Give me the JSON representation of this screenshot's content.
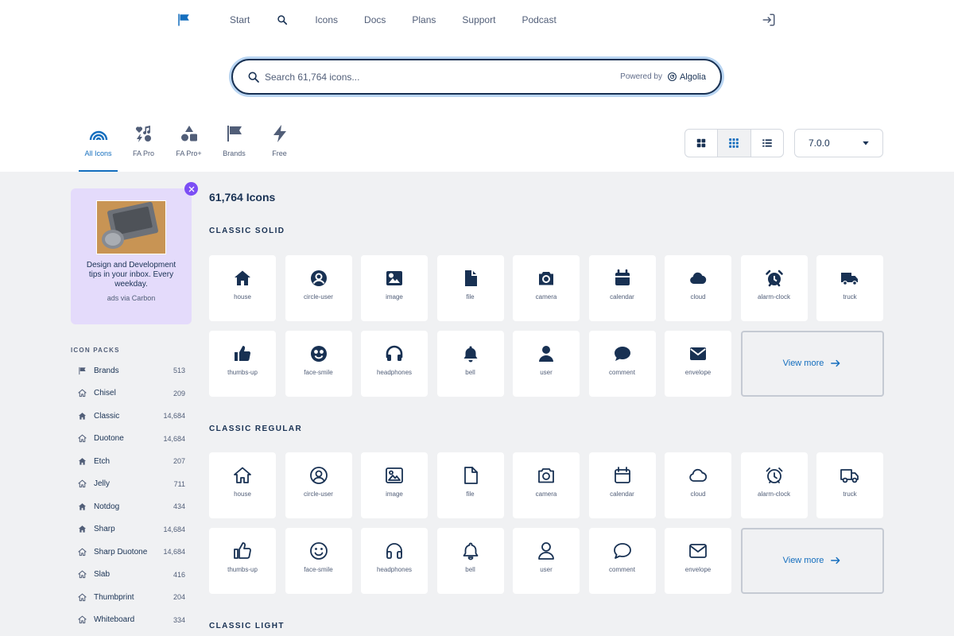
{
  "nav": {
    "items": [
      {
        "label": "Start"
      },
      {
        "label": "Icons"
      },
      {
        "label": "Docs"
      },
      {
        "label": "Plans"
      },
      {
        "label": "Support"
      },
      {
        "label": "Podcast"
      }
    ]
  },
  "search": {
    "placeholder": "Search 61,764 icons...",
    "value": "",
    "powered_by": "Powered by",
    "provider": "Algolia"
  },
  "family_tabs": [
    {
      "label": "All Icons",
      "icon": "rainbow-icon",
      "active": true
    },
    {
      "label": "FA Pro",
      "icon": "icons-icon",
      "active": false
    },
    {
      "label": "FA Pro+",
      "icon": "shapes-icon",
      "active": false
    },
    {
      "label": "Brands",
      "icon": "flag-icon",
      "active": false
    },
    {
      "label": "Free",
      "icon": "bolt-icon",
      "active": false
    }
  ],
  "view_toggle": {
    "options": [
      "large-grid",
      "small-grid",
      "list"
    ],
    "selected": "small-grid"
  },
  "version": {
    "selected": "7.0.0"
  },
  "carbon_ad": {
    "text": "Design and Development tips in your inbox. Every weekday.",
    "via": "ads via Carbon"
  },
  "packs": {
    "title": "ICON PACKS",
    "items": [
      {
        "name": "Brands",
        "count": "513",
        "icon": "flag-icon"
      },
      {
        "name": "Chisel",
        "count": "209",
        "icon": "house-icon"
      },
      {
        "name": "Classic",
        "count": "14,684",
        "icon": "house-icon"
      },
      {
        "name": "Duotone",
        "count": "14,684",
        "icon": "house-icon"
      },
      {
        "name": "Etch",
        "count": "207",
        "icon": "house-icon"
      },
      {
        "name": "Jelly",
        "count": "711",
        "icon": "house-icon"
      },
      {
        "name": "Notdog",
        "count": "434",
        "icon": "house-icon"
      },
      {
        "name": "Sharp",
        "count": "14,684",
        "icon": "house-icon"
      },
      {
        "name": "Sharp Duotone",
        "count": "14,684",
        "icon": "house-icon"
      },
      {
        "name": "Slab",
        "count": "416",
        "icon": "house-icon"
      },
      {
        "name": "Thumbprint",
        "count": "204",
        "icon": "house-icon"
      },
      {
        "name": "Whiteboard",
        "count": "334",
        "icon": "house-icon"
      }
    ]
  },
  "main": {
    "count_title": "61,764 Icons",
    "view_more": "View more",
    "sections": [
      {
        "title": "CLASSIC SOLID",
        "style": "solid",
        "icons": [
          "house",
          "circle-user",
          "image",
          "file",
          "camera",
          "calendar",
          "cloud",
          "alarm-clock",
          "truck",
          "thumbs-up",
          "face-smile",
          "headphones",
          "bell",
          "user",
          "comment",
          "envelope"
        ]
      },
      {
        "title": "CLASSIC REGULAR",
        "style": "regular",
        "icons": [
          "house",
          "circle-user",
          "image",
          "file",
          "camera",
          "calendar",
          "cloud",
          "alarm-clock",
          "truck",
          "thumbs-up",
          "face-smile",
          "headphones",
          "bell",
          "user",
          "comment",
          "envelope"
        ]
      },
      {
        "title": "CLASSIC LIGHT",
        "style": "light",
        "icons": []
      }
    ]
  },
  "colors": {
    "navy": "#183153",
    "accent_blue": "#146ebe",
    "page_bg": "#f0f1f3",
    "ad_bg": "#e4dbfb",
    "ad_close": "#7c4ef5"
  }
}
